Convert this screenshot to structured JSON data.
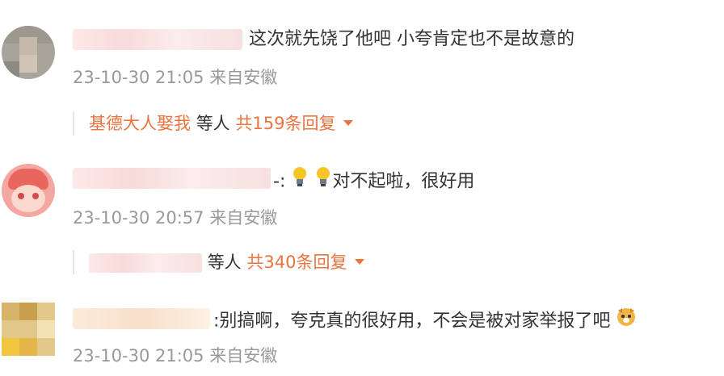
{
  "comments": [
    {
      "text": "这次就先饶了他吧 小夸肯定也不是故意的",
      "time": "23-10-30 21:05",
      "location": "来自安徽",
      "reply_name": "基德大人娶我",
      "reply_and": "等人",
      "reply_count": "共159条回复"
    },
    {
      "text": "对不起啦，很好用",
      "prefix": "-:",
      "time": "23-10-30 20:57",
      "location": "来自安徽",
      "reply_and": "等人",
      "reply_count": "共340条回复"
    },
    {
      "text": "别搞啊，夸克真的很好用，不会是被对家举报了吧",
      "prefix": ":",
      "time": "23-10-30 21:05",
      "location": "来自安徽"
    }
  ],
  "colors": {
    "accent": "#eb7340",
    "meta": "#999999",
    "text": "#333333"
  },
  "icons": {
    "lightbulb": "lightbulb-emoji",
    "dog": "dog-emoji",
    "dropdown": "caret-down-icon"
  }
}
